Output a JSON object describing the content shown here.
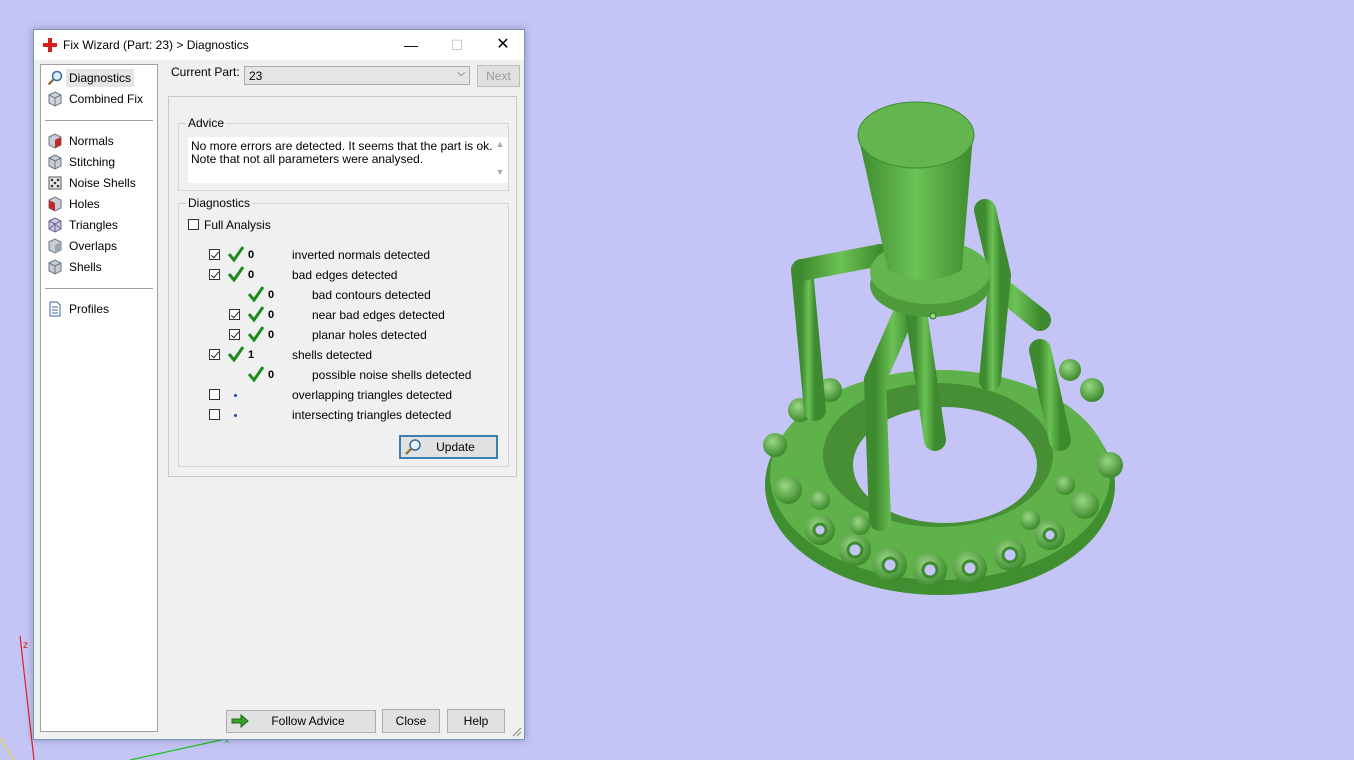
{
  "viewport": {
    "axis_label_z": "z",
    "model_color": "#5fb14a",
    "background_color": "#c4c4f6"
  },
  "dialog": {
    "title": "Fix Wizard (Part: 23) > Diagnostics",
    "title_icon": "red-cross-icon",
    "minimize": "—",
    "maximize": "☐",
    "close": "✕"
  },
  "nav": {
    "items": [
      {
        "label": "Diagnostics",
        "icon": "magnifier-icon",
        "selected": true
      },
      {
        "label": "Combined Fix",
        "icon": "cube-icon"
      },
      {
        "label": "Normals",
        "icon": "normals-cube-icon"
      },
      {
        "label": "Stitching",
        "icon": "stitching-cube-icon"
      },
      {
        "label": "Noise Shells",
        "icon": "noise-shells-icon"
      },
      {
        "label": "Holes",
        "icon": "holes-cube-icon"
      },
      {
        "label": "Triangles",
        "icon": "triangles-cube-icon"
      },
      {
        "label": "Overlaps",
        "icon": "overlaps-cube-icon"
      },
      {
        "label": "Shells",
        "icon": "shells-cube-icon"
      },
      {
        "label": "Profiles",
        "icon": "document-icon"
      }
    ]
  },
  "current_part": {
    "label": "Current Part:",
    "value": "23",
    "next_label": "Next"
  },
  "advice": {
    "title": "Advice",
    "line1": "No more errors are detected. It seems that the part is ok.",
    "line2": "Note that not all parameters were analysed."
  },
  "diagnostics": {
    "title": "Diagnostics",
    "full_analysis_label": "Full Analysis",
    "rows": [
      {
        "checkbox": true,
        "status": "ok",
        "count": "0",
        "label": "inverted normals detected"
      },
      {
        "checkbox": true,
        "status": "ok",
        "count": "0",
        "label": "bad edges detected"
      },
      {
        "checkbox": null,
        "status": "ok",
        "count": "0",
        "label": "bad contours detected"
      },
      {
        "checkbox": true,
        "status": "ok",
        "count": "0",
        "label": "near bad edges detected"
      },
      {
        "checkbox": true,
        "status": "ok",
        "count": "0",
        "label": "planar holes detected"
      },
      {
        "checkbox": true,
        "status": "ok",
        "count": "1",
        "label": "shells detected"
      },
      {
        "checkbox": null,
        "status": "ok",
        "count": "0",
        "label": "possible noise shells detected"
      },
      {
        "checkbox": false,
        "status": "pending",
        "count": "",
        "label": "overlapping triangles detected"
      },
      {
        "checkbox": false,
        "status": "pending",
        "count": "",
        "label": "intersecting triangles detected"
      }
    ],
    "update_label": "Update"
  },
  "footer": {
    "follow_advice_label": "Follow Advice",
    "close_label": "Close",
    "help_label": "Help"
  }
}
